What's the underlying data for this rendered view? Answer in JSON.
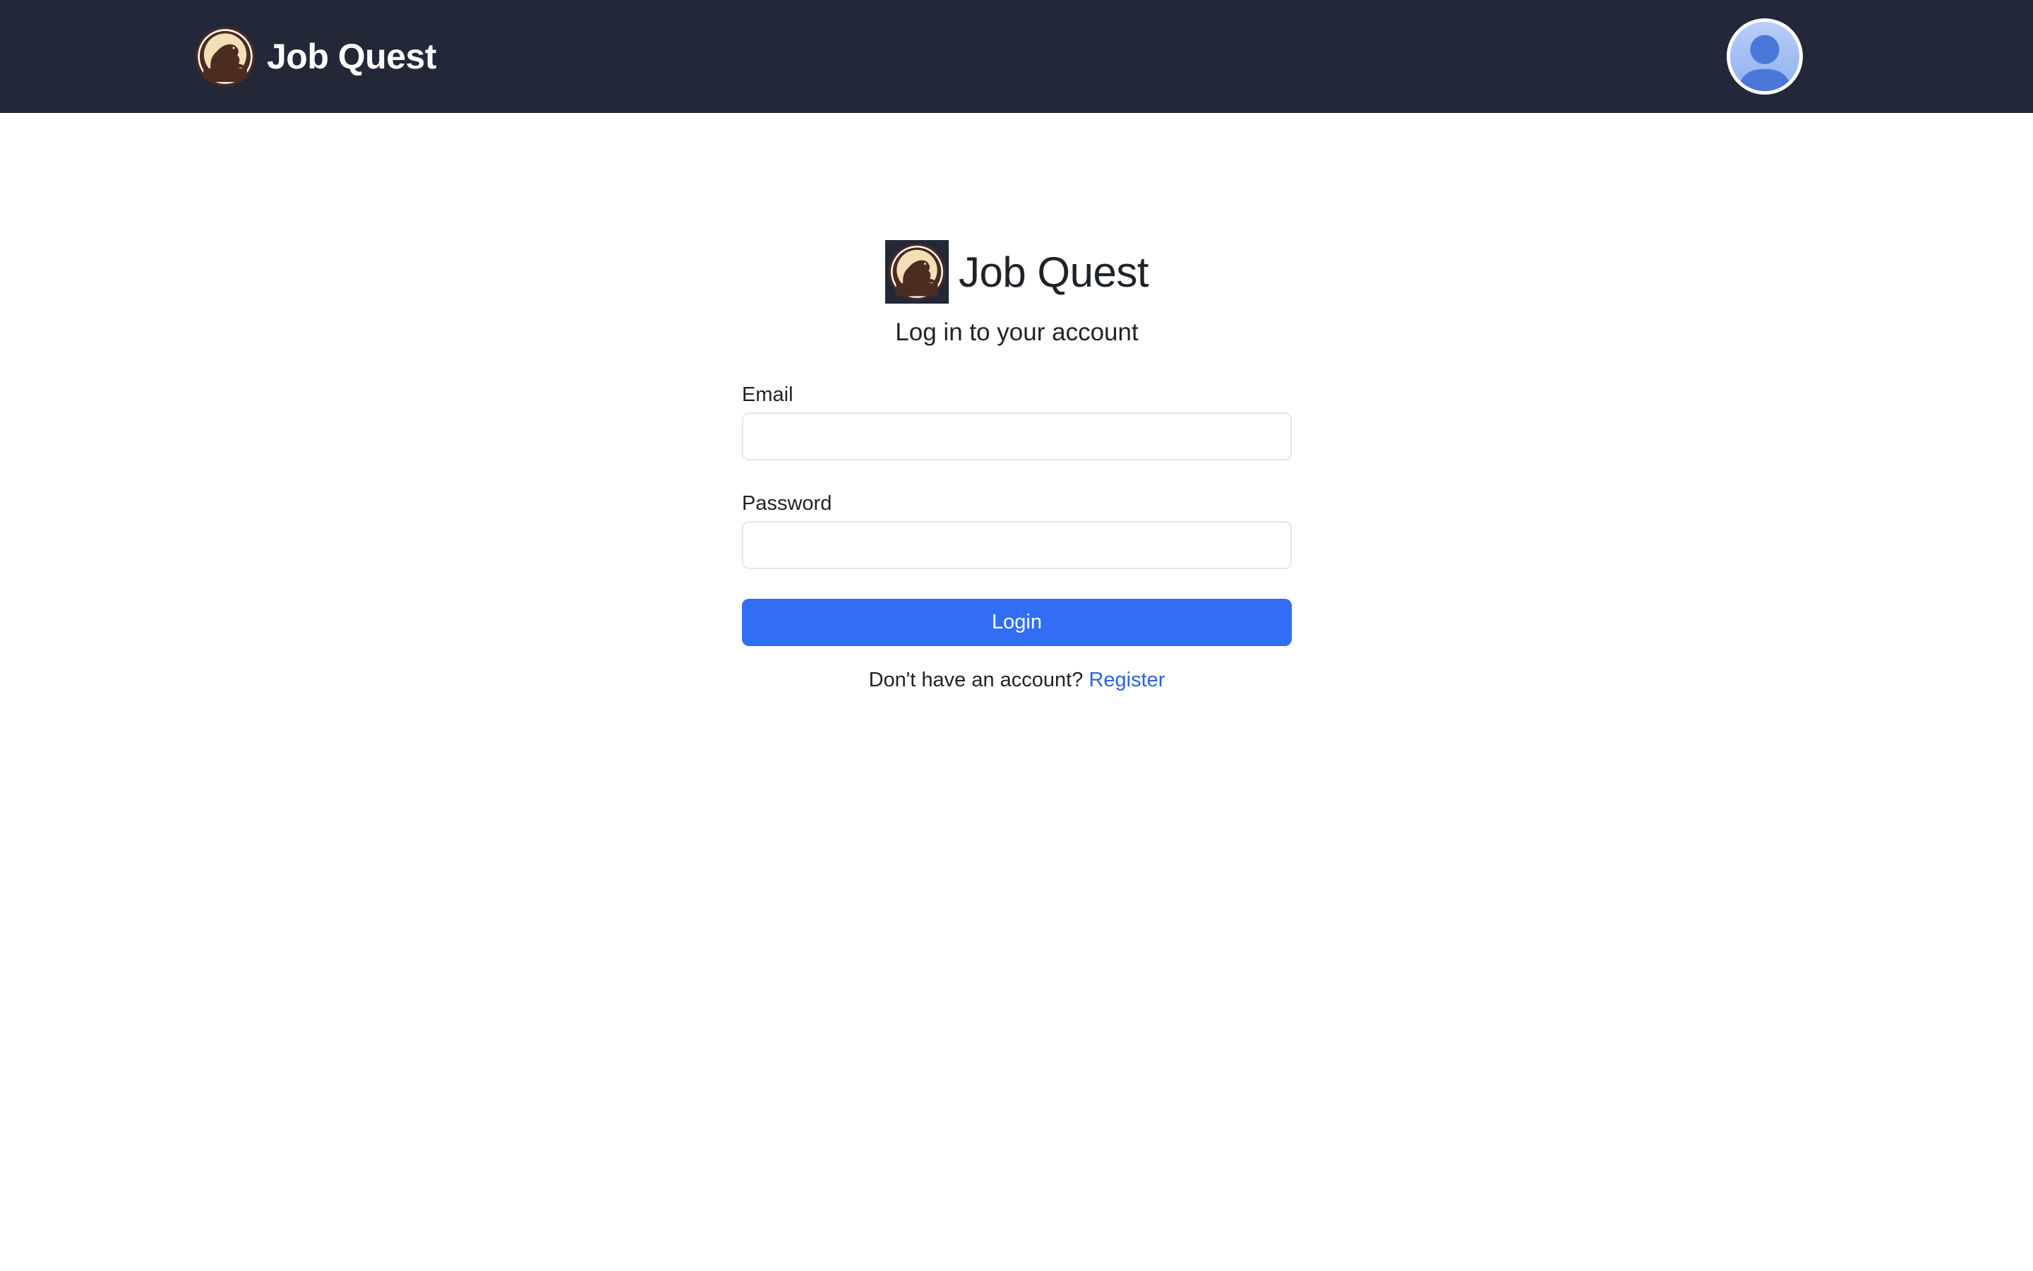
{
  "navbar": {
    "brand_name": "Job Quest",
    "logo_icon": "beaver-logo-icon",
    "avatar_icon": "user-avatar-icon"
  },
  "login": {
    "brand_name": "Job Quest",
    "subtitle": "Log in to your account",
    "email_label": "Email",
    "email_value": "",
    "password_label": "Password",
    "password_value": "",
    "button_label": "Login",
    "register_prompt": "Don't have an account?",
    "register_link": "Register"
  },
  "colors": {
    "navbar_bg": "#222838",
    "primary_button": "#326ef5",
    "link": "#2b63d9",
    "logo_cream": "#f2dfb8",
    "logo_brown": "#4a2c20"
  }
}
